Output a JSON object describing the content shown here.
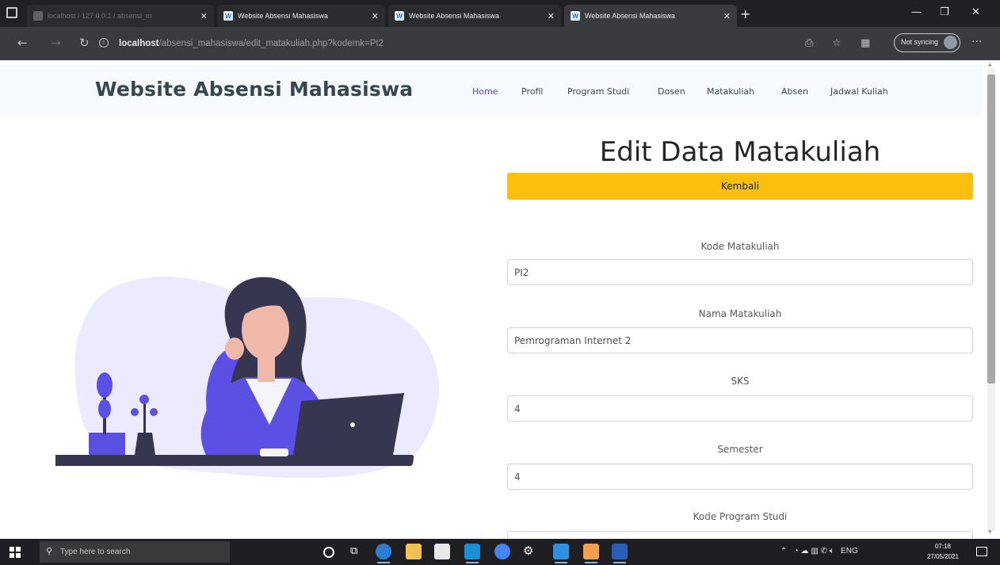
{
  "browser": {
    "tabs": [
      {
        "title": "localhost / 127.0.0.1 / absensi_m",
        "active": false,
        "faded": true
      },
      {
        "title": "Website Absensi Mahasiswa",
        "active": false,
        "faded": false
      },
      {
        "title": "Website Absensi Mahasiswa",
        "active": false,
        "faded": false
      },
      {
        "title": "Website Absensi Mahasiswa",
        "active": true,
        "faded": false
      }
    ],
    "url_host": "localhost",
    "url_path": "/absensi_mahasiswa/edit_matakuliah.php?kodemk=PI2",
    "sync_label": "Not syncing"
  },
  "site": {
    "brand": "Website Absensi Mahasiswa",
    "nav": [
      "Home",
      "Profil",
      "Program Studi",
      "Dosen",
      "Matakuliah",
      "Absen",
      "Jadwal Kuliah"
    ],
    "active_nav": "Home"
  },
  "form": {
    "title": "Edit Data Matakuliah",
    "back_label": "Kembali",
    "fields": [
      {
        "label": "Kode Matakuliah",
        "value": "PI2"
      },
      {
        "label": "Nama Matakuliah",
        "value": "Pemrograman Internet 2"
      },
      {
        "label": "SKS",
        "value": "4"
      },
      {
        "label": "Semester",
        "value": "4"
      },
      {
        "label": "Kode Program Studi",
        "value": ""
      }
    ]
  },
  "taskbar": {
    "search_placeholder": "Type here to search",
    "lang": "ENG",
    "time": "07:18",
    "date": "27/05/2021"
  },
  "colors": {
    "accent_nav": "#4f46e5",
    "warning_button": "#fbbf0d",
    "brand_text": "#37474f",
    "illustration_purple": "#5b50e3"
  }
}
